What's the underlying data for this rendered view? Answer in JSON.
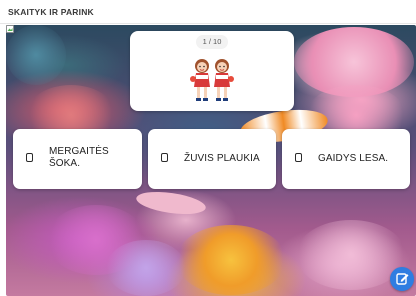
{
  "header": {
    "title": "SKAITYK IR PARINK"
  },
  "question": {
    "counter": "1 / 10",
    "image_icon": "dancing-girls-illustration"
  },
  "answers": [
    {
      "label": "MERGAITĖS ŠOKA."
    },
    {
      "label": "ŽUVIS PLAUKIA"
    },
    {
      "label": "GAIDYS LESA."
    }
  ],
  "fab": {
    "icon": "edit-icon",
    "color": "#2f7de1"
  },
  "background": {
    "icon": "coral-reef-photo"
  }
}
